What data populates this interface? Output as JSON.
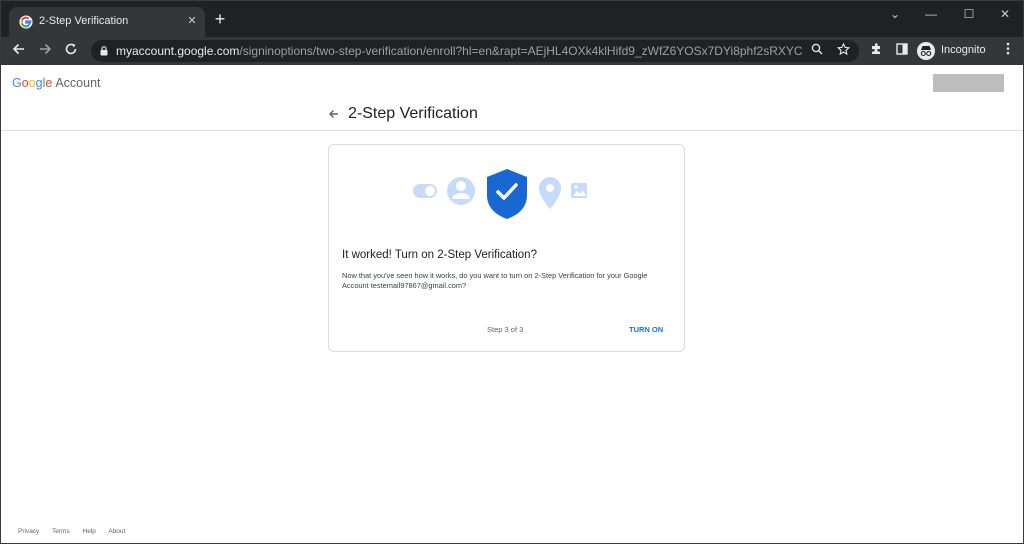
{
  "browser": {
    "tab_title": "2-Step Verification",
    "tab_close": "✕",
    "new_tab": "+",
    "url_host": "myaccount.google.com",
    "url_path": "/signinoptions/two-step-verification/enroll?hl=en&rapt=AEjHL4OXk4klHifd9_zWfZ6YOSx7DYi8phf2sRXYC33V_k...",
    "profile_label": "Incognito",
    "minimize": "—",
    "maximize": "☐",
    "close": "✕",
    "tab_dropdown": "⌄"
  },
  "header": {
    "brand": {
      "letters": [
        {
          "ch": "G",
          "color": "#4285f4"
        },
        {
          "ch": "o",
          "color": "#ea4335"
        },
        {
          "ch": "o",
          "color": "#fbbc05"
        },
        {
          "ch": "g",
          "color": "#4285f4"
        },
        {
          "ch": "l",
          "color": "#34a853"
        },
        {
          "ch": "e",
          "color": "#ea4335"
        }
      ],
      "account": "Account"
    },
    "page_title": "2-Step Verification"
  },
  "card": {
    "title": "It worked! Turn on 2-Step Verification?",
    "body": "Now that you've seen how it works, do you want to turn on 2-Step Verification for your Google Account testemail97867@gmail.com?",
    "step": "Step 3 of 3",
    "action": "TURN ON"
  },
  "footer": {
    "links": [
      "Privacy",
      "Terms",
      "Help",
      "About"
    ]
  },
  "colors": {
    "accent": "#1a73e8",
    "shield": "#1967d2",
    "illustration_light": "#c6dafc"
  }
}
